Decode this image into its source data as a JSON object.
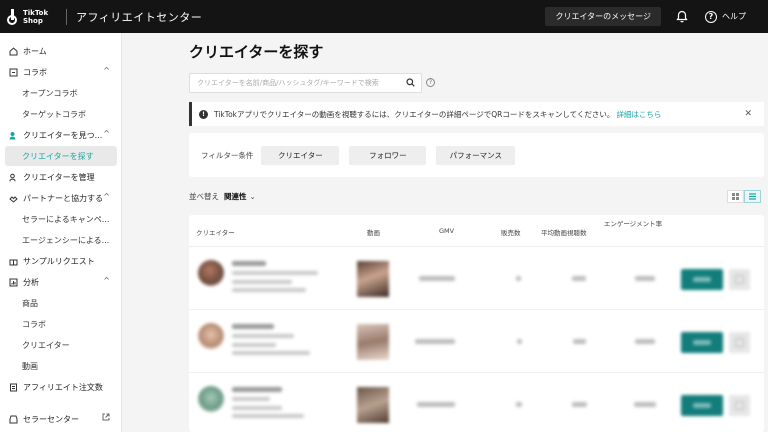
{
  "header": {
    "logo_line1": "TikTok",
    "logo_line2": "Shop",
    "title": "アフィリエイトセンター",
    "message_button": "クリエイターのメッセージ",
    "help_label": "ヘルプ"
  },
  "sidebar": {
    "items": [
      {
        "label": "ホーム",
        "icon": "home-icon"
      },
      {
        "label": "コラボ",
        "icon": "collab-icon"
      },
      {
        "label": "オープンコラボ"
      },
      {
        "label": "ターゲットコラボ"
      },
      {
        "label": "クリエイターを見つ...",
        "icon": "user-search-icon"
      },
      {
        "label": "クリエイターを探す"
      },
      {
        "label": "クリエイターを管理",
        "icon": "users-icon"
      },
      {
        "label": "パートナーと協力する",
        "icon": "partner-icon"
      },
      {
        "label": "セラーによるキャンペ..."
      },
      {
        "label": "エージェンシーによる..."
      },
      {
        "label": "サンプルリクエスト",
        "icon": "sample-icon"
      },
      {
        "label": "分析",
        "icon": "analytics-icon"
      },
      {
        "label": "商品"
      },
      {
        "label": "コラボ"
      },
      {
        "label": "クリエイター"
      },
      {
        "label": "動画"
      },
      {
        "label": "アフィリエイト注文数",
        "icon": "orders-icon"
      },
      {
        "label": "セラーセンター",
        "icon": "seller-center-icon"
      }
    ]
  },
  "main": {
    "title": "クリエイターを探す",
    "search_placeholder": "クリエイターを名前/商品/ハッシュタグ/キーワードで検索",
    "notice_text": "TikTokアプリでクリエイターの動画を視聴するには、クリエイターの詳細ページでQRコードをスキャンしてください。",
    "notice_link": "詳細はこちら",
    "filter_label": "フィルター条件",
    "filters": [
      "クリエイター",
      "フォロワー",
      "パフォーマンス"
    ],
    "sort_label": "並べ替え",
    "sort_value": "関連性",
    "columns": [
      "クリエイター",
      "動画",
      "GMV",
      "販売数",
      "平均動画視聴数",
      "エンゲージメント率"
    ]
  },
  "colors": {
    "accent": "#1aa5a5",
    "primary_button": "#127d7b",
    "topbar": "#141414"
  }
}
